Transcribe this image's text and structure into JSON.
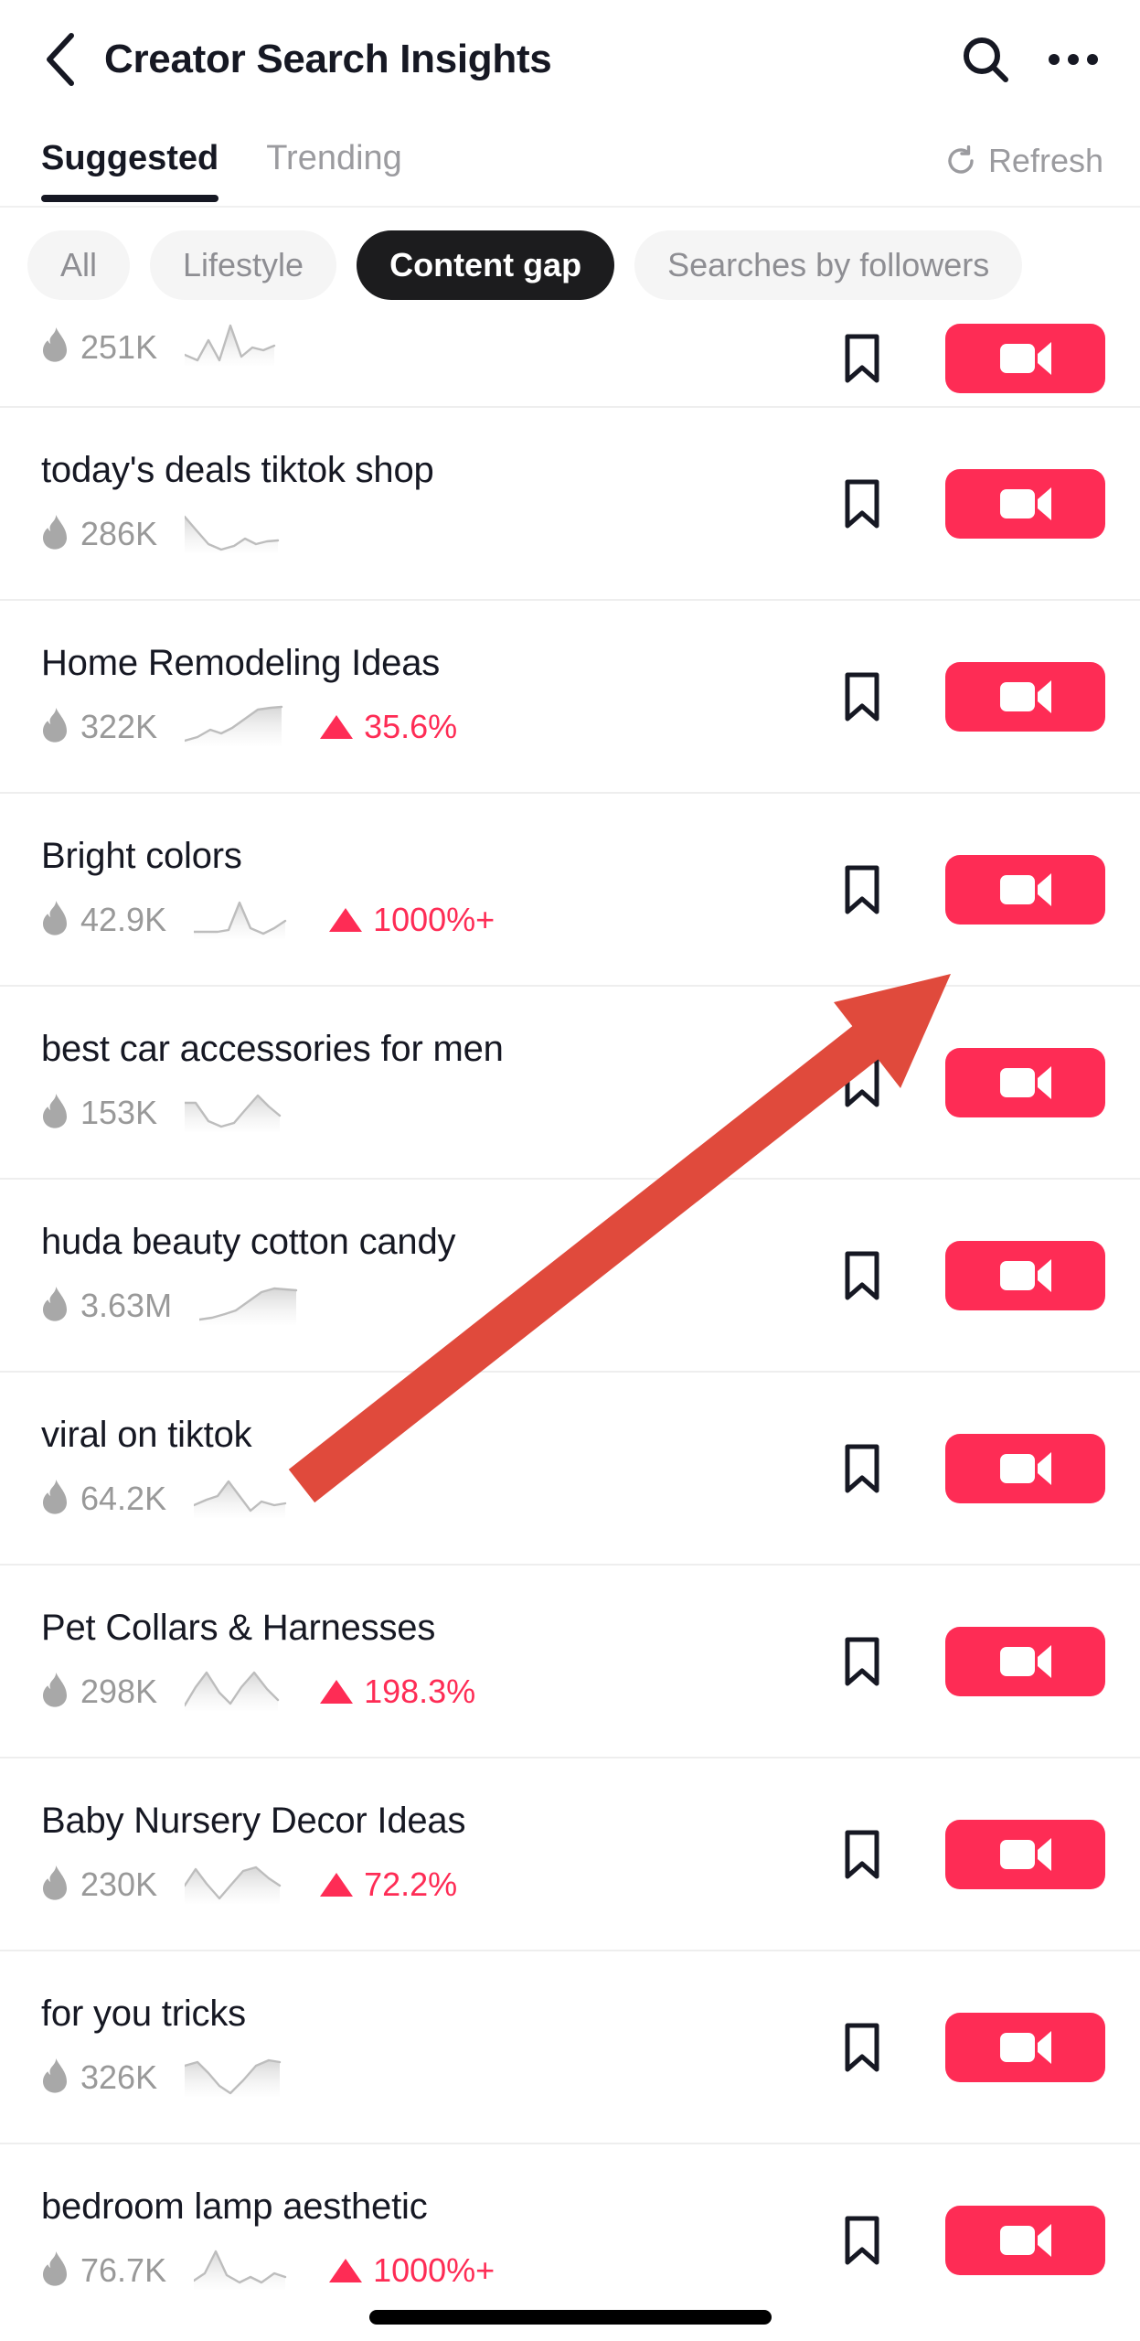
{
  "header": {
    "back_icon": "chevron-left-icon",
    "title": "Creator Search Insights",
    "search_icon": "search-icon",
    "more_icon": "more-options-icon"
  },
  "tabs": [
    {
      "label": "Suggested",
      "active": true
    },
    {
      "label": "Trending",
      "active": false
    }
  ],
  "refresh": {
    "label": "Refresh",
    "icon": "refresh-icon"
  },
  "filters": [
    {
      "label": "All",
      "selected": false
    },
    {
      "label": "Lifestyle",
      "selected": false
    },
    {
      "label": "Content gap",
      "selected": true
    },
    {
      "label": "Searches by followers",
      "selected": false
    }
  ],
  "row_actions": {
    "bookmark_icon": "bookmark-icon",
    "video_icon": "video-camera-icon"
  },
  "colors": {
    "accent": "#fe2c55",
    "chip_selected_bg": "#1c1c1e",
    "chip_bg": "#f5f5f5",
    "text_primary": "#161823",
    "text_muted": "#999999",
    "annotation_arrow": "#e04a3c"
  },
  "list": [
    {
      "title": "",
      "count": "251K",
      "trend": "",
      "partial": true,
      "spark": "0,34 14,40 26,18 38,40 50,2 62,36 74,26 86,29 98,24"
    },
    {
      "title": "today's deals tiktok shop",
      "count": "286K",
      "trend": "",
      "spark": "0,6 12,20 26,36 40,42 54,38 66,30 78,36 90,33 102,32"
    },
    {
      "title": "Home Remodeling Ideas",
      "count": "322K",
      "trend": "35.6%",
      "spark": "0,40 14,36 28,28 40,32 52,26 66,16 80,6 94,4 106,3"
    },
    {
      "title": "Bright colors",
      "count": "42.9K",
      "trend": "1000%+",
      "spark": "0,38 14,38 26,38 38,36 50,6 62,34 76,40 88,34 100,26"
    },
    {
      "title": "best car accessories for men",
      "count": "153K",
      "trend": "",
      "spark": "0,14 12,14 26,34 40,40 54,36 66,22 80,6 92,18 104,28"
    },
    {
      "title": "huda beauty cotton candy",
      "count": "3.63M",
      "trend": "",
      "spark": "0,40 14,38 28,34 40,30 54,20 68,10 82,6 94,7 106,8"
    },
    {
      "title": "viral on tiktok",
      "count": "64.2K",
      "trend": "",
      "spark": "0,32 14,26 26,22 38,6 50,22 62,38 74,28 88,32 100,30"
    },
    {
      "title": "Pet Collars & Harnesses",
      "count": "298K",
      "trend": "198.3%",
      "spark": "0,40 12,20 24,4 38,26 50,38 62,20 76,4 90,22 102,34"
    },
    {
      "title": "Baby Nursery Decor Ideas",
      "count": "230K",
      "trend": "72.2%",
      "spark": "0,26 12,8 24,24 38,40 50,26 64,10 78,6 92,18 104,26"
    },
    {
      "title": "for you tricks",
      "count": "326K",
      "trend": "",
      "spark": "0,12 14,8 26,20 38,34 50,42 64,28 78,12 92,6 104,8"
    },
    {
      "title": "bedroom lamp aesthetic",
      "count": "76.7K",
      "trend": "1000%+",
      "spark": "0,36 12,28 24,4 36,30 50,38 62,32 74,38 88,28 100,32"
    }
  ]
}
